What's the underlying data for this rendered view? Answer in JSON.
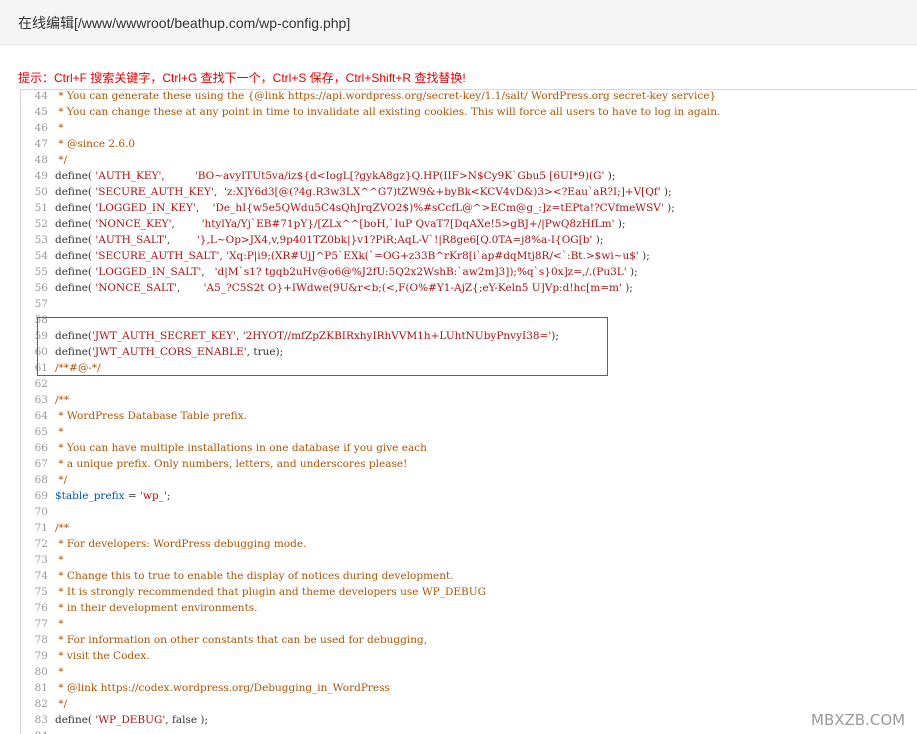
{
  "window": {
    "title": "在线编辑[/www/wwwroot/beathup.com/wp-config.php]"
  },
  "hint_text": "提示：Ctrl+F 搜索关键字，Ctrl+G 查找下一个，Ctrl+S 保存，Ctrl+Shift+R 查找替换!",
  "editor": {
    "lines": [
      {
        "n": "44",
        "t": " * You can generate these using the {@link https://api.wordpress.org/secret-key/1.1/salt/ WordPress.org secret-key service}",
        "c": "com"
      },
      {
        "n": "45",
        "t": " * You can change these at any point in time to invalidate all existing cookies. This will force all users to have to log in again.",
        "c": "com"
      },
      {
        "n": "46",
        "t": " *",
        "c": "com"
      },
      {
        "n": "47",
        "t": " * @since 2.6.0",
        "c": "com"
      },
      {
        "n": "48",
        "t": " */",
        "c": "com"
      },
      {
        "n": "49",
        "t": "define( 'AUTH_KEY',         'BO~avyITUt5va/iz${d<IogL[?gykA8gz}Q.HP(IIF>N$Cy9K`Gbu5 [6UI*9)(G' );",
        "c": "def"
      },
      {
        "n": "50",
        "t": "define( 'SECURE_AUTH_KEY',  'z:X]Y6d3[@(?4g.R3w3LX^^G7)tZW9&+byBk<KCV4vD&)3><?Eau`aR?I;]+V[Qf' );",
        "c": "def"
      },
      {
        "n": "51",
        "t": "define( 'LOGGED_IN_KEY',    'De_hI{w5e5QWdu5C4sQhJrqZVO2$)%#sCcfL@^>ECm@g_:]z=tEPta!?CVfmeWSV' );",
        "c": "def"
      },
      {
        "n": "52",
        "t": "define( 'NONCE_KEY',        'htylYa/Yj`EB#71pY}/[ZLx^^[boH,`IuP QvaT7[DqAXe!5>gBJ+/|PwQ8zHfLm' );",
        "c": "def"
      },
      {
        "n": "53",
        "t": "define( 'AUTH_SALT',        '},L~Op>JX4,v,9p401TZ0bk|}v1?PiR;AqL-V`!|R8ge6[Q.0TA=j8%a-I{OG[b' );",
        "c": "def"
      },
      {
        "n": "54",
        "t": "define( 'SECURE_AUTH_SALT', 'Xq:P|i9;(XR#UjJ^P5`EXk(`=OG+z33B^rKr8[i`ap#dqMtj8R/<`:Bt.>$wi~u$' );",
        "c": "def"
      },
      {
        "n": "55",
        "t": "define( 'LOGGED_IN_SALT',   'd|M`s1? tgqb2uHv@o6@%J2fU:5Q2x2WshB:`aw2m]3]);%q`s}0x]z=,/.(Pu3L' );",
        "c": "def"
      },
      {
        "n": "56",
        "t": "define( 'NONCE_SALT',       'A5_?C5S2t O}+IWdwe(9U&r<b;(<,F(O%#Y1-AjZ{;eY-Keln5 U]Vp:d!hc[m=m' );",
        "c": "def"
      },
      {
        "n": "57",
        "t": "",
        "c": "plain"
      },
      {
        "n": "58",
        "t": "",
        "c": "plain"
      },
      {
        "n": "59",
        "t": "define('JWT_AUTH_SECRET_KEY', '2HYOT//mfZpZKBIRxhyIRhVVM1h+LUhtNUbyPnvyI38=');",
        "c": "def"
      },
      {
        "n": "60",
        "t": "define('JWT_AUTH_CORS_ENABLE', true);",
        "c": "def"
      },
      {
        "n": "61",
        "t": "/**#@-*/",
        "c": "com"
      },
      {
        "n": "62",
        "t": "",
        "c": "plain"
      },
      {
        "n": "63",
        "t": "/**",
        "c": "com"
      },
      {
        "n": "64",
        "t": " * WordPress Database Table prefix.",
        "c": "com"
      },
      {
        "n": "65",
        "t": " *",
        "c": "com"
      },
      {
        "n": "66",
        "t": " * You can have multiple installations in one database if you give each",
        "c": "com"
      },
      {
        "n": "67",
        "t": " * a unique prefix. Only numbers, letters, and underscores please!",
        "c": "com"
      },
      {
        "n": "68",
        "t": " */",
        "c": "com"
      },
      {
        "n": "69",
        "t": "$table_prefix = 'wp_';",
        "c": "var"
      },
      {
        "n": "70",
        "t": "",
        "c": "plain"
      },
      {
        "n": "71",
        "t": "/**",
        "c": "com"
      },
      {
        "n": "72",
        "t": " * For developers: WordPress debugging mode.",
        "c": "com"
      },
      {
        "n": "73",
        "t": " *",
        "c": "com"
      },
      {
        "n": "74",
        "t": " * Change this to true to enable the display of notices during development.",
        "c": "com"
      },
      {
        "n": "75",
        "t": " * It is strongly recommended that plugin and theme developers use WP_DEBUG",
        "c": "com"
      },
      {
        "n": "76",
        "t": " * in their development environments.",
        "c": "com"
      },
      {
        "n": "77",
        "t": " *",
        "c": "com"
      },
      {
        "n": "78",
        "t": " * For information on other constants that can be used for debugging,",
        "c": "com"
      },
      {
        "n": "79",
        "t": " * visit the Codex.",
        "c": "com"
      },
      {
        "n": "80",
        "t": " *",
        "c": "com"
      },
      {
        "n": "81",
        "t": " * @link https://codex.wordpress.org/Debugging_in_WordPress",
        "c": "com"
      },
      {
        "n": "82",
        "t": " */",
        "c": "com"
      },
      {
        "n": "83",
        "t": "define( 'WP_DEBUG', false );",
        "c": "def"
      },
      {
        "n": "84",
        "t": "",
        "c": "plain"
      }
    ]
  },
  "watermark": "MBXZB.COM",
  "colors": {
    "hint": "#e60000",
    "highlight_border": "#d93025",
    "string": "#aa1111",
    "comment": "#aa5500",
    "variable": "#0055aa"
  }
}
